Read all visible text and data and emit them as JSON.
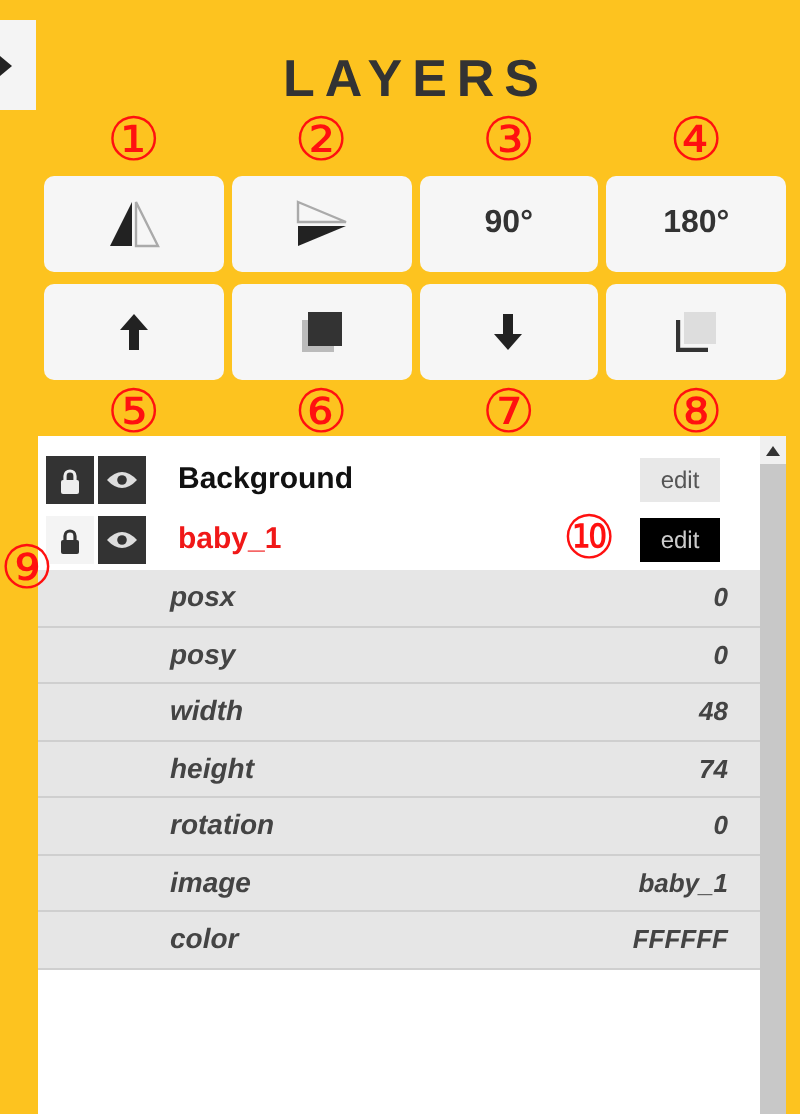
{
  "title": "LAYERS",
  "button_rows": [
    {
      "annotations_above": [
        "①",
        "②",
        "③",
        "④"
      ],
      "buttons": [
        {
          "kind": "flip-horizontal"
        },
        {
          "kind": "flip-vertical"
        },
        {
          "kind": "text",
          "label": "90°"
        },
        {
          "kind": "text",
          "label": "180°"
        }
      ]
    },
    {
      "annotations_below": [
        "⑤",
        "⑥",
        "⑦",
        "⑧"
      ],
      "buttons": [
        {
          "kind": "move-up"
        },
        {
          "kind": "to-front"
        },
        {
          "kind": "move-down"
        },
        {
          "kind": "to-back"
        }
      ]
    }
  ],
  "layers": [
    {
      "name": "Background",
      "locked": true,
      "visible": true,
      "selected": false,
      "edit": "edit"
    },
    {
      "name": "baby_1",
      "locked": false,
      "visible": true,
      "selected": true,
      "edit": "edit",
      "lock_annotation": "⑨",
      "edit_annotation": "⑩",
      "properties": [
        {
          "name": "posx",
          "value": "0"
        },
        {
          "name": "posy",
          "value": "0"
        },
        {
          "name": "width",
          "value": "48"
        },
        {
          "name": "height",
          "value": "74"
        },
        {
          "name": "rotation",
          "value": "0"
        },
        {
          "name": "image",
          "value": "baby_1"
        },
        {
          "name": "color",
          "value": "FFFFFF"
        }
      ]
    }
  ]
}
